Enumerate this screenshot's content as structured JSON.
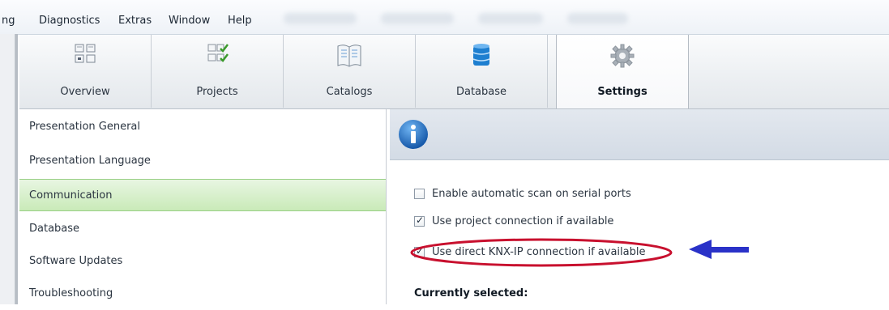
{
  "menu": {
    "items": [
      "ng",
      "Diagnostics",
      "Extras",
      "Window",
      "Help"
    ]
  },
  "tabs": [
    {
      "label": "Overview",
      "icon": "overview-icon"
    },
    {
      "label": "Projects",
      "icon": "projects-icon"
    },
    {
      "label": "Catalogs",
      "icon": "catalogs-icon"
    },
    {
      "label": "Database",
      "icon": "database-icon"
    },
    {
      "label": "Settings",
      "icon": "settings-gear-icon",
      "active": true
    }
  ],
  "sidebar": {
    "items": [
      {
        "label": "Presentation General"
      },
      {
        "label": "Presentation Language"
      },
      {
        "label": "Communication",
        "selected": true
      },
      {
        "label": "Database"
      },
      {
        "label": "Software Updates"
      },
      {
        "label": "Troubleshooting"
      }
    ]
  },
  "content": {
    "options": [
      {
        "label": "Enable automatic scan on serial ports",
        "checked": false
      },
      {
        "label": "Use project connection if available",
        "checked": true
      },
      {
        "label": "Use direct KNX-IP connection if available",
        "checked": true
      }
    ],
    "currently_selected_title": "Currently selected:"
  },
  "colors": {
    "selected_item": "#c9eab8",
    "annotation_red": "#c8102e",
    "annotation_arrow": "#2a32c8",
    "info_blue": "#1f6fc2"
  }
}
